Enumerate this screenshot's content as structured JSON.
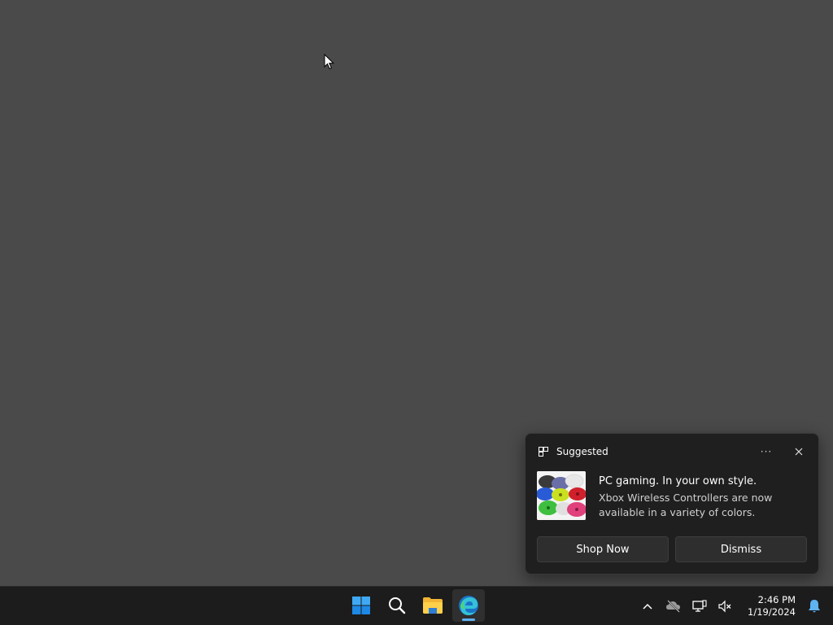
{
  "toast": {
    "app_name": "Suggested",
    "title": "PC gaming. In your own style.",
    "body": "Xbox Wireless Controllers are now available in a variety of colors.",
    "more_glyph": "···",
    "actions": {
      "primary": "Shop Now",
      "secondary": "Dismiss"
    }
  },
  "taskbar": {
    "apps": [
      {
        "name": "Start",
        "icon": "windows-logo-icon"
      },
      {
        "name": "Search",
        "icon": "search-icon"
      },
      {
        "name": "File Explorer",
        "icon": "folder-icon"
      },
      {
        "name": "Microsoft Edge",
        "icon": "edge-icon",
        "active": true
      }
    ],
    "tray": {
      "chevron": "show-hidden-icons-icon",
      "onedrive": "onedrive-offline-icon",
      "network": "network-icon",
      "volume": "volume-muted-icon"
    },
    "clock": {
      "time": "2:46 PM",
      "date": "1/19/2024"
    }
  },
  "colors": {
    "desktop": "#4a4a4a",
    "taskbar": "#1c1c1c",
    "toast_bg": "#1f1f1f",
    "accent": "#5fb2f2"
  }
}
